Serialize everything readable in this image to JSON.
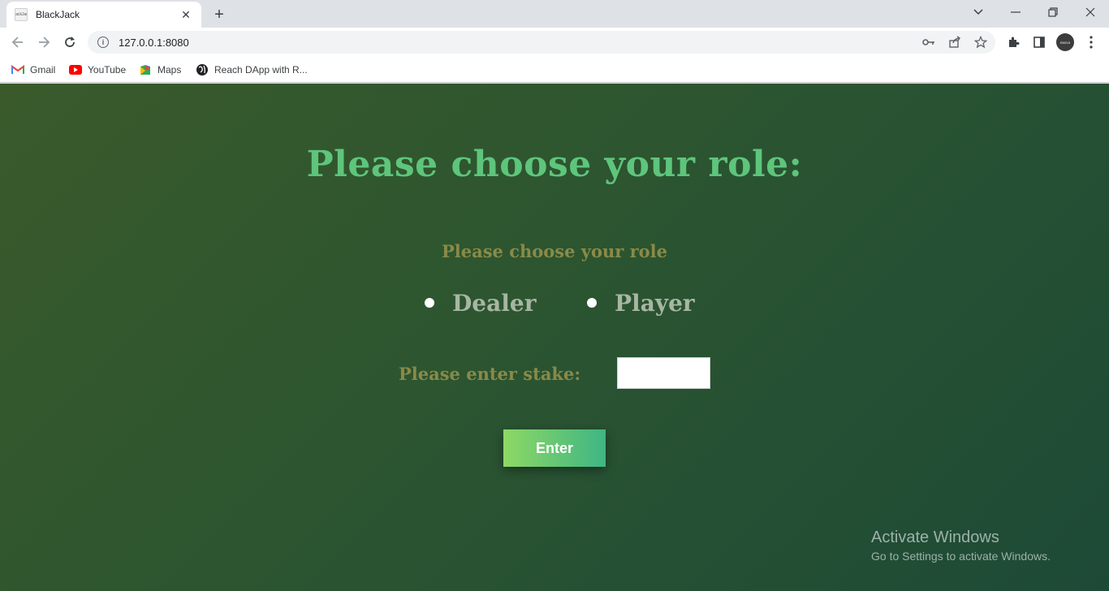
{
  "browser": {
    "tab": {
      "favicon_text": "BlackJack",
      "title": "BlackJack"
    },
    "address_bar": {
      "url": "127.0.0.1:8080"
    },
    "profile_initials": "EMOJI",
    "bookmarks": [
      {
        "label": "Gmail",
        "icon": "gmail-icon"
      },
      {
        "label": "YouTube",
        "icon": "youtube-icon"
      },
      {
        "label": "Maps",
        "icon": "maps-icon"
      },
      {
        "label": "Reach DApp with R...",
        "icon": "globe-icon"
      }
    ]
  },
  "page": {
    "heading": "Please choose your role:",
    "role_prompt": "Please choose your role",
    "roles": [
      {
        "label": "Dealer",
        "selected": false
      },
      {
        "label": "Player",
        "selected": false
      }
    ],
    "stake_label": "Please enter stake:",
    "stake_value": "",
    "enter_button": "Enter"
  },
  "watermark": {
    "title": "Activate Windows",
    "subtitle": "Go to Settings to activate Windows."
  },
  "colors": {
    "heading": "#5ec57c",
    "prompt": "#8a8a48",
    "radio_label": "#a7b6a3",
    "button_start": "#8ed865",
    "button_end": "#3eb683",
    "background_dark": "#1d4a37",
    "background_light": "#3a5a2b"
  }
}
